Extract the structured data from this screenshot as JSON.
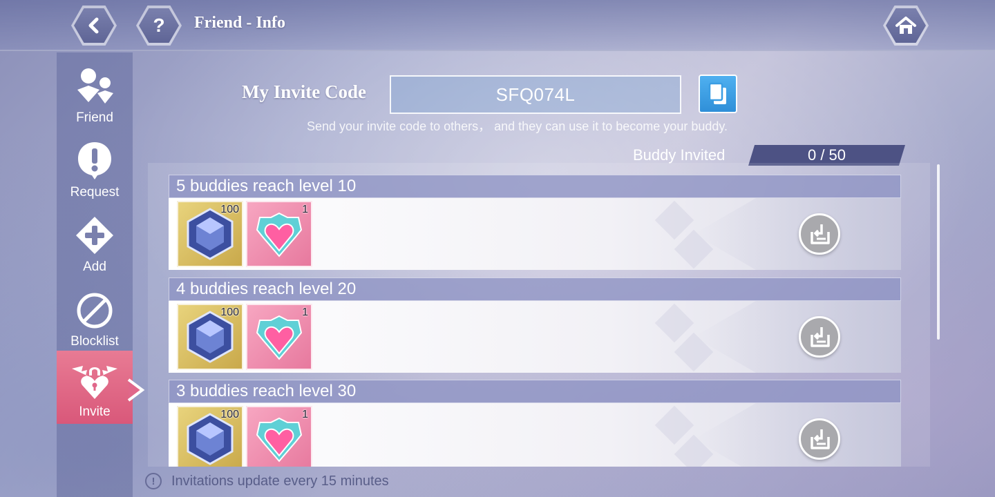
{
  "header": {
    "title": "Friend - Info",
    "back_icon": "back-arrow-icon",
    "help_icon": "help-question-icon",
    "home_icon": "home-icon"
  },
  "sidebar": {
    "items": [
      {
        "label": "Friend",
        "icon": "friends-icon",
        "active": false
      },
      {
        "label": "Request",
        "icon": "exclamation-icon",
        "active": false
      },
      {
        "label": "Add",
        "icon": "plus-icon",
        "active": false
      },
      {
        "label": "Blocklist",
        "icon": "block-icon",
        "active": false
      },
      {
        "label": "Invite",
        "icon": "winged-heart-lock-icon",
        "active": true
      }
    ]
  },
  "invite": {
    "label": "My Invite Code",
    "code": "SFQ074L",
    "hint": "Send your invite code to others， and they can use it to become your buddy.",
    "copy_icon": "copy-icon"
  },
  "buddy": {
    "label": "Buddy Invited",
    "count": "0 / 50"
  },
  "tasks": [
    {
      "title": "5 buddies reach level 10",
      "rewards": [
        {
          "item": "blue-crystal-icon",
          "qty": "100"
        },
        {
          "item": "heart-gem-icon",
          "qty": "1"
        }
      ]
    },
    {
      "title": "4 buddies reach level 20",
      "rewards": [
        {
          "item": "blue-crystal-icon",
          "qty": "100"
        },
        {
          "item": "heart-gem-icon",
          "qty": "1"
        }
      ]
    },
    {
      "title": "3 buddies reach level 30",
      "rewards": [
        {
          "item": "blue-crystal-icon",
          "qty": "100"
        },
        {
          "item": "heart-gem-icon",
          "qty": "1"
        }
      ]
    }
  ],
  "footer": {
    "text": "Invitations update every 15 minutes",
    "icon": "info-icon"
  },
  "colors": {
    "active_tab": "#e0678a",
    "copy_button": "#3a9de3",
    "counter_bg": "#4d5284",
    "claim_button": "#a9a9ad"
  }
}
